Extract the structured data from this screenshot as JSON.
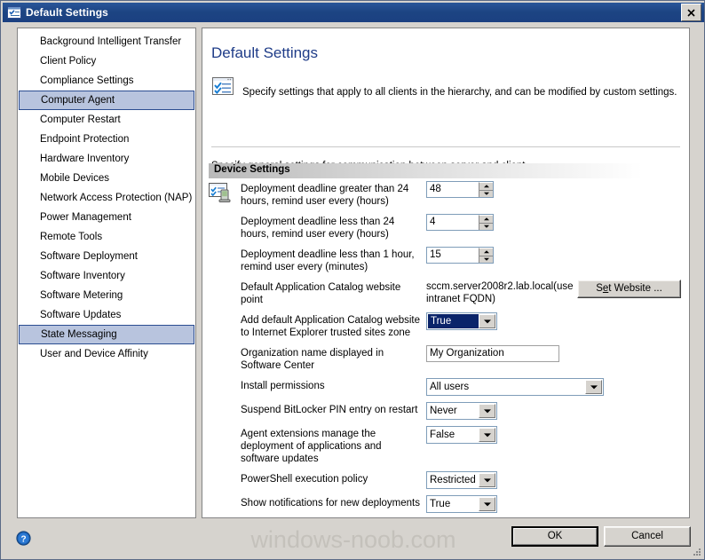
{
  "window": {
    "title": "Default Settings",
    "icon": "settings-checklist-icon",
    "close_label": "✕"
  },
  "sidebar": {
    "items": [
      {
        "label": "Background Intelligent Transfer",
        "selected": false
      },
      {
        "label": "Client Policy",
        "selected": false
      },
      {
        "label": "Compliance Settings",
        "selected": false
      },
      {
        "label": "Computer Agent",
        "selected": true
      },
      {
        "label": "Computer Restart",
        "selected": false
      },
      {
        "label": "Endpoint Protection",
        "selected": false
      },
      {
        "label": "Hardware Inventory",
        "selected": false
      },
      {
        "label": "Mobile Devices",
        "selected": false
      },
      {
        "label": "Network Access Protection (NAP)",
        "selected": false
      },
      {
        "label": "Power Management",
        "selected": false
      },
      {
        "label": "Remote Tools",
        "selected": false
      },
      {
        "label": "Software Deployment",
        "selected": false
      },
      {
        "label": "Software Inventory",
        "selected": false
      },
      {
        "label": "Software Metering",
        "selected": false
      },
      {
        "label": "Software Updates",
        "selected": false
      },
      {
        "label": "State Messaging",
        "selected": true
      },
      {
        "label": "User and Device Affinity",
        "selected": false
      }
    ]
  },
  "panel": {
    "title": "Default Settings",
    "description": "Specify settings that apply to all clients in the hierarchy, and can be modified by custom settings.",
    "subtext": "Specify general settings for communication between server and client",
    "section_header": "Device Settings",
    "settings": [
      {
        "label": "Deployment deadline greater than 24 hours, remind user every (hours)",
        "control": "spinner",
        "value": "48"
      },
      {
        "label": "Deployment deadline less than 24 hours, remind user every (hours)",
        "control": "spinner",
        "value": "4"
      },
      {
        "label": "Deployment deadline less than 1 hour, remind user every (minutes)",
        "control": "spinner",
        "value": "15"
      },
      {
        "label": "Default Application Catalog website point",
        "control": "static-with-button",
        "value": "sccm.server2008r2.lab.local(use intranet FQDN)",
        "button_label_pre": "S",
        "button_label_accel": "e",
        "button_label_post": "t Website ..."
      },
      {
        "label": "Add default Application Catalog website to Internet Explorer trusted sites zone",
        "control": "combo-small",
        "value": "True",
        "focused": true
      },
      {
        "label": "Organization name displayed in Software Center",
        "control": "textbox",
        "value": "My Organization"
      },
      {
        "label": "Install permissions",
        "control": "combo-wide",
        "value": "All users"
      },
      {
        "label": "Suspend BitLocker PIN entry on restart",
        "control": "combo-small",
        "value": "Never"
      },
      {
        "label": "Agent extensions manage the deployment of applications and software updates",
        "control": "combo-small",
        "value": "False"
      },
      {
        "label": "PowerShell execution policy",
        "control": "combo-small",
        "value": "Restricted"
      },
      {
        "label": "Show notifications for new deployments",
        "control": "combo-small",
        "value": "True"
      }
    ]
  },
  "footer": {
    "help_icon": "help-question-icon",
    "watermark": "windows-noob.com",
    "ok_label": "OK",
    "cancel_label": "Cancel"
  },
  "colors": {
    "titlebar": "#1c4482",
    "dialog_bg": "#d6d3ce",
    "panel_title": "#1f3c88",
    "selection_fill": "#b8c4de",
    "selection_border": "#2b4d91",
    "combo_focus": "#0a246a",
    "watermark": "#c4c1bb"
  }
}
